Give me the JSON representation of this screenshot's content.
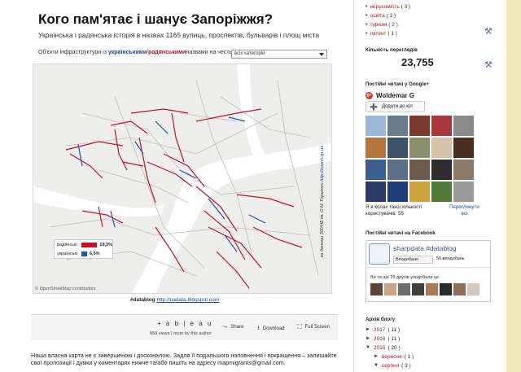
{
  "post": {
    "title": "Кого пам'ятає і шанує Запоріжжя?",
    "subtitle": "Українська і радянська історія в назвах 1165 вулиць, проспектів, бульварів і площ міста",
    "filter": {
      "prefix": "Об'єкти інфраструктури із",
      "ukr": "українськими",
      "sep": " / ",
      "sov": "радянськими",
      "suffix": " назвами на честь",
      "selected": "всіх категорій"
    },
    "map": {
      "legend": [
        {
          "label": "радянські",
          "value": "19,3%",
          "color": "#c8102e"
        },
        {
          "label": "українські",
          "value": "6,5%",
          "color": "#1f55b3"
        }
      ],
      "attribution": "© OpenStreetMap contributors",
      "credit_text": "за даними ЗОУНБ ім. О.М. Горького ",
      "credit_link": "http://zounb.zp.ua"
    },
    "datablog": {
      "tag": "#datablog",
      "link": "http://uadata.blogspot.com"
    },
    "tableau": {
      "logo": "+ a b | e a u",
      "views": "559 views | more by this author",
      "share": "Share",
      "download": "Download",
      "fullscreen": "Full Screen"
    },
    "body": "Наша власна карта не є завершеною і досконалою. Задля її подальшого наповнення і покращення – залишайте свої пропозиції і думки у коментарях нижче та/або пишіть на адресу mapmigrants@gmail.com."
  },
  "sidebar": {
    "labels": [
      {
        "name": "нерухомість",
        "count": "( 3 )"
      },
      {
        "name": "освіта",
        "count": "( 3 )"
      },
      {
        "name": "туризм",
        "count": "( 2 )"
      },
      {
        "name": "патент",
        "count": "( 1 )"
      }
    ],
    "pageviews": {
      "title": "Кількість переглядів",
      "count": "23,755"
    },
    "gplus": {
      "title": "Постійні читачі у Google+",
      "name": "Woldemar G",
      "add_button": "Додати до кіл",
      "stats_line1": "Я в колах такої кількості",
      "stats_line2": "користувачів: 55",
      "more_line1": "Переглянути",
      "more_line2": "всі"
    },
    "facebook": {
      "title": "Постійні читачі на Facebook",
      "page_name": "sharpdata #datablog",
      "like_button": "Вподобано",
      "likes": "56 вподобань",
      "friends": "Ви та ще 25 друзів уподобали це"
    },
    "archive": {
      "title": "Архів блогу",
      "items": [
        {
          "tri": "►",
          "label": "2017",
          "count": "( 11 )",
          "level": 0
        },
        {
          "tri": "►",
          "label": "2016",
          "count": "( 11 )",
          "level": 0
        },
        {
          "tri": "▼",
          "label": "2015",
          "count": "( 20 )",
          "level": 0
        },
        {
          "tri": "►",
          "label": "вересня",
          "count": "( 1 )",
          "level": 1
        },
        {
          "tri": "▼",
          "label": "серпня",
          "count": "( 3 )",
          "level": 1
        }
      ]
    }
  }
}
